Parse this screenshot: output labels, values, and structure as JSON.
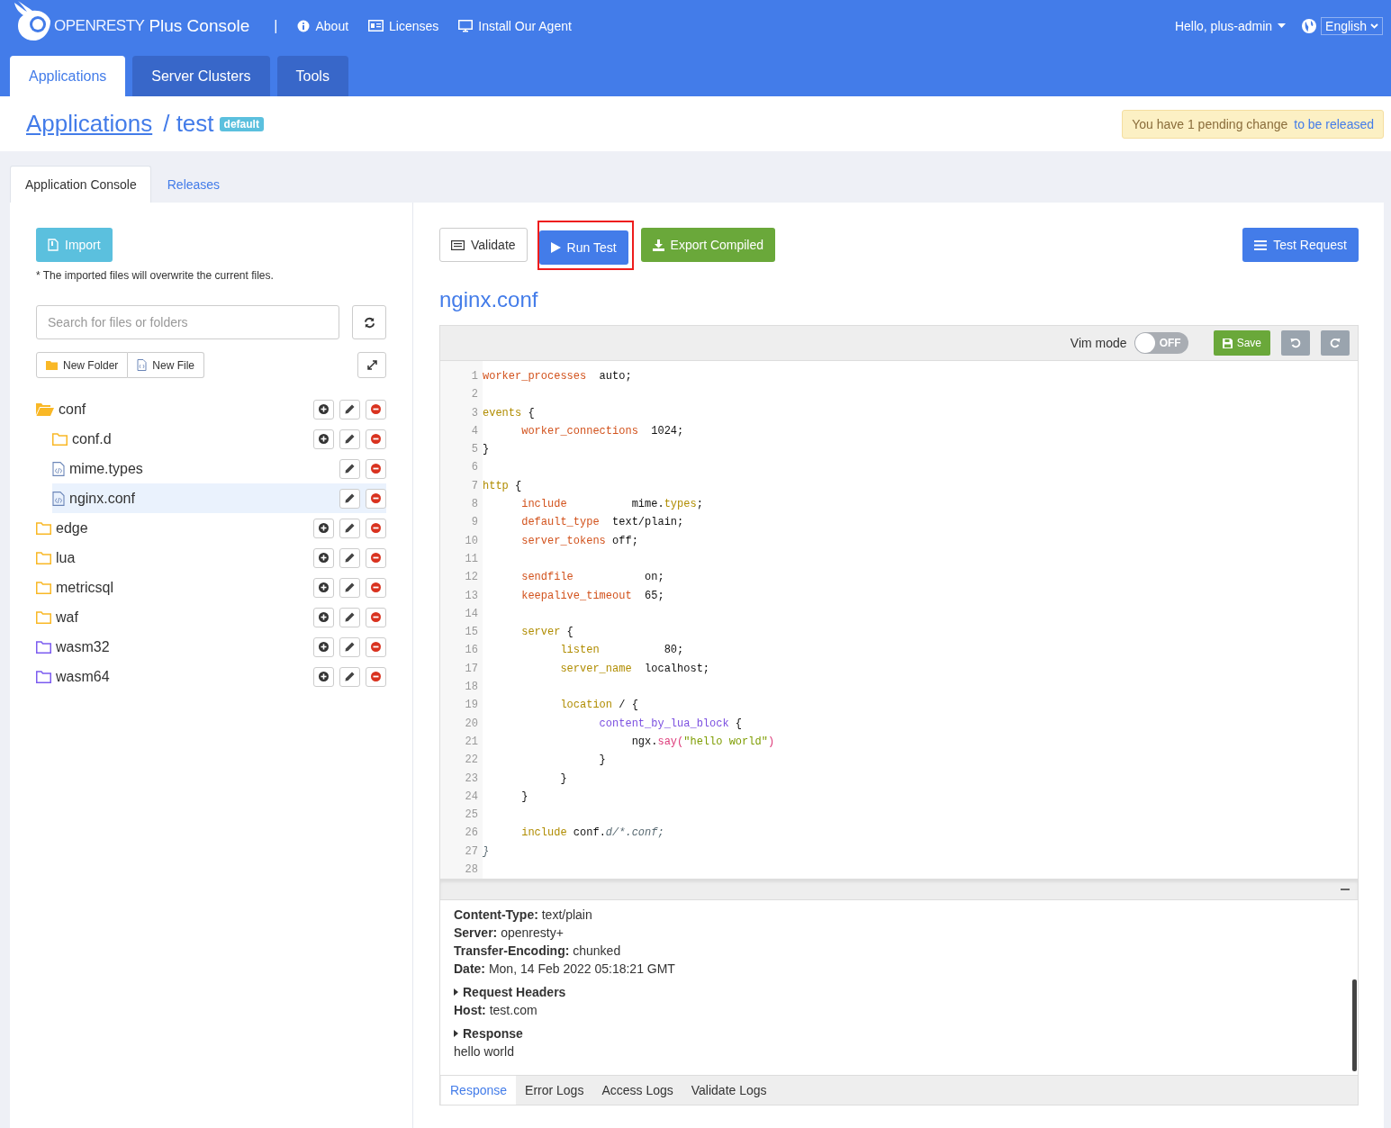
{
  "header": {
    "logo": "**OPEN**RESTY",
    "title": "Plus Console",
    "separator": "|",
    "links": [
      {
        "label": "About"
      },
      {
        "label": "Licenses"
      },
      {
        "label": "Install Our Agent"
      }
    ],
    "user": "Hello, plus-admin",
    "language": "English"
  },
  "main_tabs": [
    {
      "label": "Applications",
      "selected": true
    },
    {
      "label": "Server Clusters",
      "selected": false
    },
    {
      "label": "Tools",
      "selected": false
    }
  ],
  "breadcrumb": {
    "root": "Applications",
    "separator": "/",
    "current": "test",
    "badge": "default"
  },
  "alert": {
    "text": "You have 1 pending change",
    "link": "to be released"
  },
  "page_tabs": [
    {
      "label": "Application Console",
      "selected": true
    },
    {
      "label": "Releases",
      "selected": false
    }
  ],
  "files": {
    "import_button": "Import",
    "note": "* The imported files will overwrite the current files.",
    "search": {
      "placeholder": "Search for files or folders"
    },
    "new_folder": "New Folder",
    "new_file": "New File",
    "tree": [
      {
        "name": "conf",
        "kind": "folder",
        "expanded": true,
        "selected": false,
        "color": "#f9b826",
        "children": [
          {
            "name": "conf.d",
            "kind": "folder",
            "expanded": false,
            "selected": false,
            "color": "#f9b826"
          },
          {
            "name": "mime.types",
            "kind": "file",
            "selected": false
          },
          {
            "name": "nginx.conf",
            "kind": "file",
            "selected": true
          }
        ]
      },
      {
        "name": "edge",
        "kind": "folder",
        "expanded": false,
        "selected": false,
        "color": "#f9b826"
      },
      {
        "name": "lua",
        "kind": "folder",
        "expanded": false,
        "selected": false,
        "color": "#f9b826"
      },
      {
        "name": "metricsql",
        "kind": "folder",
        "expanded": false,
        "selected": false,
        "color": "#f9b826"
      },
      {
        "name": "waf",
        "kind": "folder",
        "expanded": false,
        "selected": false,
        "color": "#f9b826"
      },
      {
        "name": "wasm32",
        "kind": "folder",
        "expanded": false,
        "selected": false,
        "color": "#7c5cf0"
      },
      {
        "name": "wasm64",
        "kind": "folder",
        "expanded": false,
        "selected": false,
        "color": "#7c5cf0"
      }
    ]
  },
  "editor": {
    "toolbar": [
      {
        "label": "Validate",
        "kind": "default",
        "highlighted": false
      },
      {
        "label": "Run Test",
        "kind": "primary",
        "highlighted": true
      },
      {
        "label": "Export Compiled",
        "kind": "success",
        "highlighted": false
      }
    ],
    "test_request": "Test Request",
    "filename": "nginx.conf",
    "vim_mode": {
      "label": "Vim mode",
      "on": false,
      "state_text": "OFF"
    },
    "save": "Save",
    "lines": [
      {
        "num": "1",
        "tokens": [
          {
            "t": "worker_processes",
            "kind": "directive"
          },
          {
            "t": "  auto;",
            "kind": "plain"
          }
        ]
      },
      {
        "num": "2"
      },
      {
        "num": "3",
        "tokens": [
          {
            "t": "events",
            "kind": "block"
          },
          {
            "t": " {",
            "kind": "plain"
          }
        ]
      },
      {
        "num": "4",
        "tokens": [
          {
            "t": "      worker_connections",
            "kind": "directive"
          },
          {
            "t": "  1024;",
            "kind": "plain"
          }
        ]
      },
      {
        "num": "5",
        "tokens": [
          {
            "t": "}",
            "kind": "plain"
          }
        ]
      },
      {
        "num": "6"
      },
      {
        "num": "7",
        "tokens": [
          {
            "t": "http",
            "kind": "block"
          },
          {
            "t": " {",
            "kind": "plain"
          }
        ]
      },
      {
        "num": "8",
        "tokens": [
          {
            "t": "      include",
            "kind": "directive"
          },
          {
            "t": "          mime.",
            "kind": "plain"
          },
          {
            "t": "types",
            "kind": "block"
          },
          {
            "t": ";",
            "kind": "plain"
          }
        ]
      },
      {
        "num": "9",
        "tokens": [
          {
            "t": "      default_type",
            "kind": "directive"
          },
          {
            "t": "  text/plain;",
            "kind": "plain"
          }
        ]
      },
      {
        "num": "10",
        "tokens": [
          {
            "t": "      server_tokens",
            "kind": "directive"
          },
          {
            "t": " off;",
            "kind": "plain"
          }
        ]
      },
      {
        "num": "11"
      },
      {
        "num": "12",
        "tokens": [
          {
            "t": "      sendfile",
            "kind": "directive"
          },
          {
            "t": "           on;",
            "kind": "plain"
          }
        ]
      },
      {
        "num": "13",
        "tokens": [
          {
            "t": "      keepalive_timeout",
            "kind": "directive"
          },
          {
            "t": "  65;",
            "kind": "plain"
          }
        ]
      },
      {
        "num": "14"
      },
      {
        "num": "15",
        "tokens": [
          {
            "t": "      server",
            "kind": "block"
          },
          {
            "t": " {",
            "kind": "plain"
          }
        ]
      },
      {
        "num": "16",
        "tokens": [
          {
            "t": "            listen",
            "kind": "block"
          },
          {
            "t": "          80;",
            "kind": "plain"
          }
        ]
      },
      {
        "num": "17",
        "tokens": [
          {
            "t": "            server_name",
            "kind": "block"
          },
          {
            "t": "  localhost;",
            "kind": "plain"
          }
        ]
      },
      {
        "num": "18"
      },
      {
        "num": "19",
        "tokens": [
          {
            "t": "            location",
            "kind": "block"
          },
          {
            "t": " / {",
            "kind": "plain"
          }
        ]
      },
      {
        "num": "20",
        "tokens": [
          {
            "t": "                  content_by_lua_block",
            "kind": "lua"
          },
          {
            "t": " {",
            "kind": "plain"
          }
        ]
      },
      {
        "num": "21",
        "tokens": [
          {
            "t": "                       ngx.",
            "kind": "plain"
          },
          {
            "t": "say(",
            "kind": "func"
          },
          {
            "t": "\"hello world\"",
            "kind": "string"
          },
          {
            "t": ")",
            "kind": "func"
          }
        ]
      },
      {
        "num": "22",
        "tokens": [
          {
            "t": "                  }",
            "kind": "plain"
          }
        ]
      },
      {
        "num": "23",
        "tokens": [
          {
            "t": "            }",
            "kind": "plain"
          }
        ]
      },
      {
        "num": "24",
        "tokens": [
          {
            "t": "      }",
            "kind": "plain"
          }
        ]
      },
      {
        "num": "25"
      },
      {
        "num": "26",
        "tokens": [
          {
            "t": "      include",
            "kind": "block"
          },
          {
            "t": " conf.",
            "kind": "plain"
          },
          {
            "t": "d/*.conf;",
            "kind": "comment"
          }
        ]
      },
      {
        "num": "27",
        "tokens": [
          {
            "t": "}",
            "kind": "comment"
          }
        ]
      },
      {
        "num": "28"
      }
    ]
  },
  "response": {
    "blocks": [
      {
        "kind": "headers",
        "rows": [
          {
            "key": "Content-Type:",
            "value": "text/plain"
          },
          {
            "key": "Server:",
            "value": "openresty+"
          },
          {
            "key": "Transfer-Encoding:",
            "value": "chunked"
          },
          {
            "key": "Date:",
            "value": "Mon, 14 Feb 2022 05:18:21 GMT"
          }
        ]
      },
      {
        "kind": "section",
        "title": "Request Headers"
      },
      {
        "kind": "headers",
        "rows": [
          {
            "key": "Host:",
            "value": "test.com"
          }
        ]
      },
      {
        "kind": "section",
        "title": "Response"
      },
      {
        "kind": "text",
        "text": "hello world"
      }
    ],
    "tabs": [
      {
        "label": "Response",
        "selected": true
      },
      {
        "label": "Error Logs",
        "selected": false
      },
      {
        "label": "Access Logs",
        "selected": false
      },
      {
        "label": "Validate Logs",
        "selected": false
      }
    ]
  }
}
